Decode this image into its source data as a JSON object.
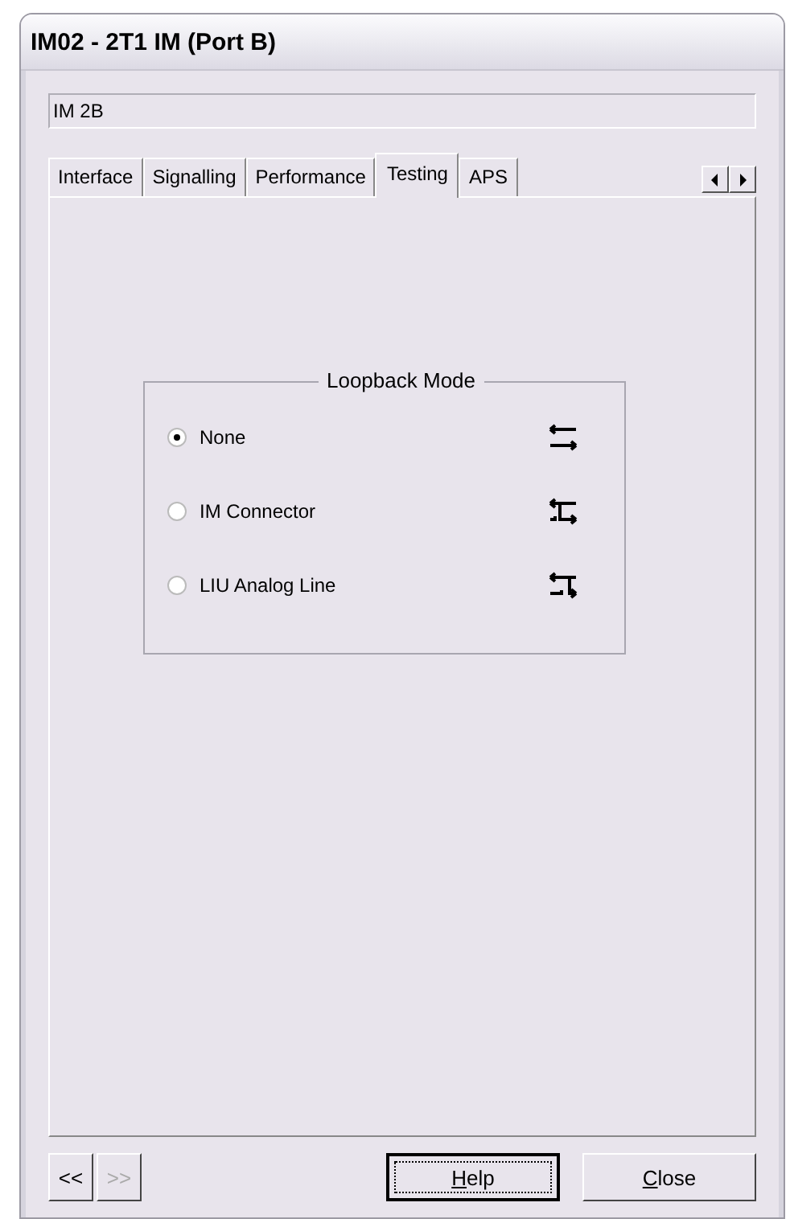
{
  "window": {
    "title": "IM02 - 2T1 IM (Port B)"
  },
  "name_field": {
    "value": "IM 2B"
  },
  "tabs": [
    {
      "label": "Interface",
      "selected": false
    },
    {
      "label": "Signalling",
      "selected": false
    },
    {
      "label": "Performance",
      "selected": false
    },
    {
      "label": "Testing",
      "selected": true
    },
    {
      "label": "APS",
      "selected": false
    }
  ],
  "loopback_mode": {
    "title": "Loopback Mode",
    "options": [
      {
        "label": "None",
        "selected": true,
        "kind": "none"
      },
      {
        "label": "IM Connector",
        "selected": false,
        "kind": "connector"
      },
      {
        "label": "LIU Analog Line",
        "selected": false,
        "kind": "line"
      }
    ]
  },
  "nav_buttons": [
    {
      "label": "<<",
      "disabled": false
    },
    {
      "label": ">>",
      "disabled": true
    }
  ],
  "buttons": [
    {
      "label": "Help",
      "default": true
    },
    {
      "label": "Close",
      "default": false
    }
  ]
}
